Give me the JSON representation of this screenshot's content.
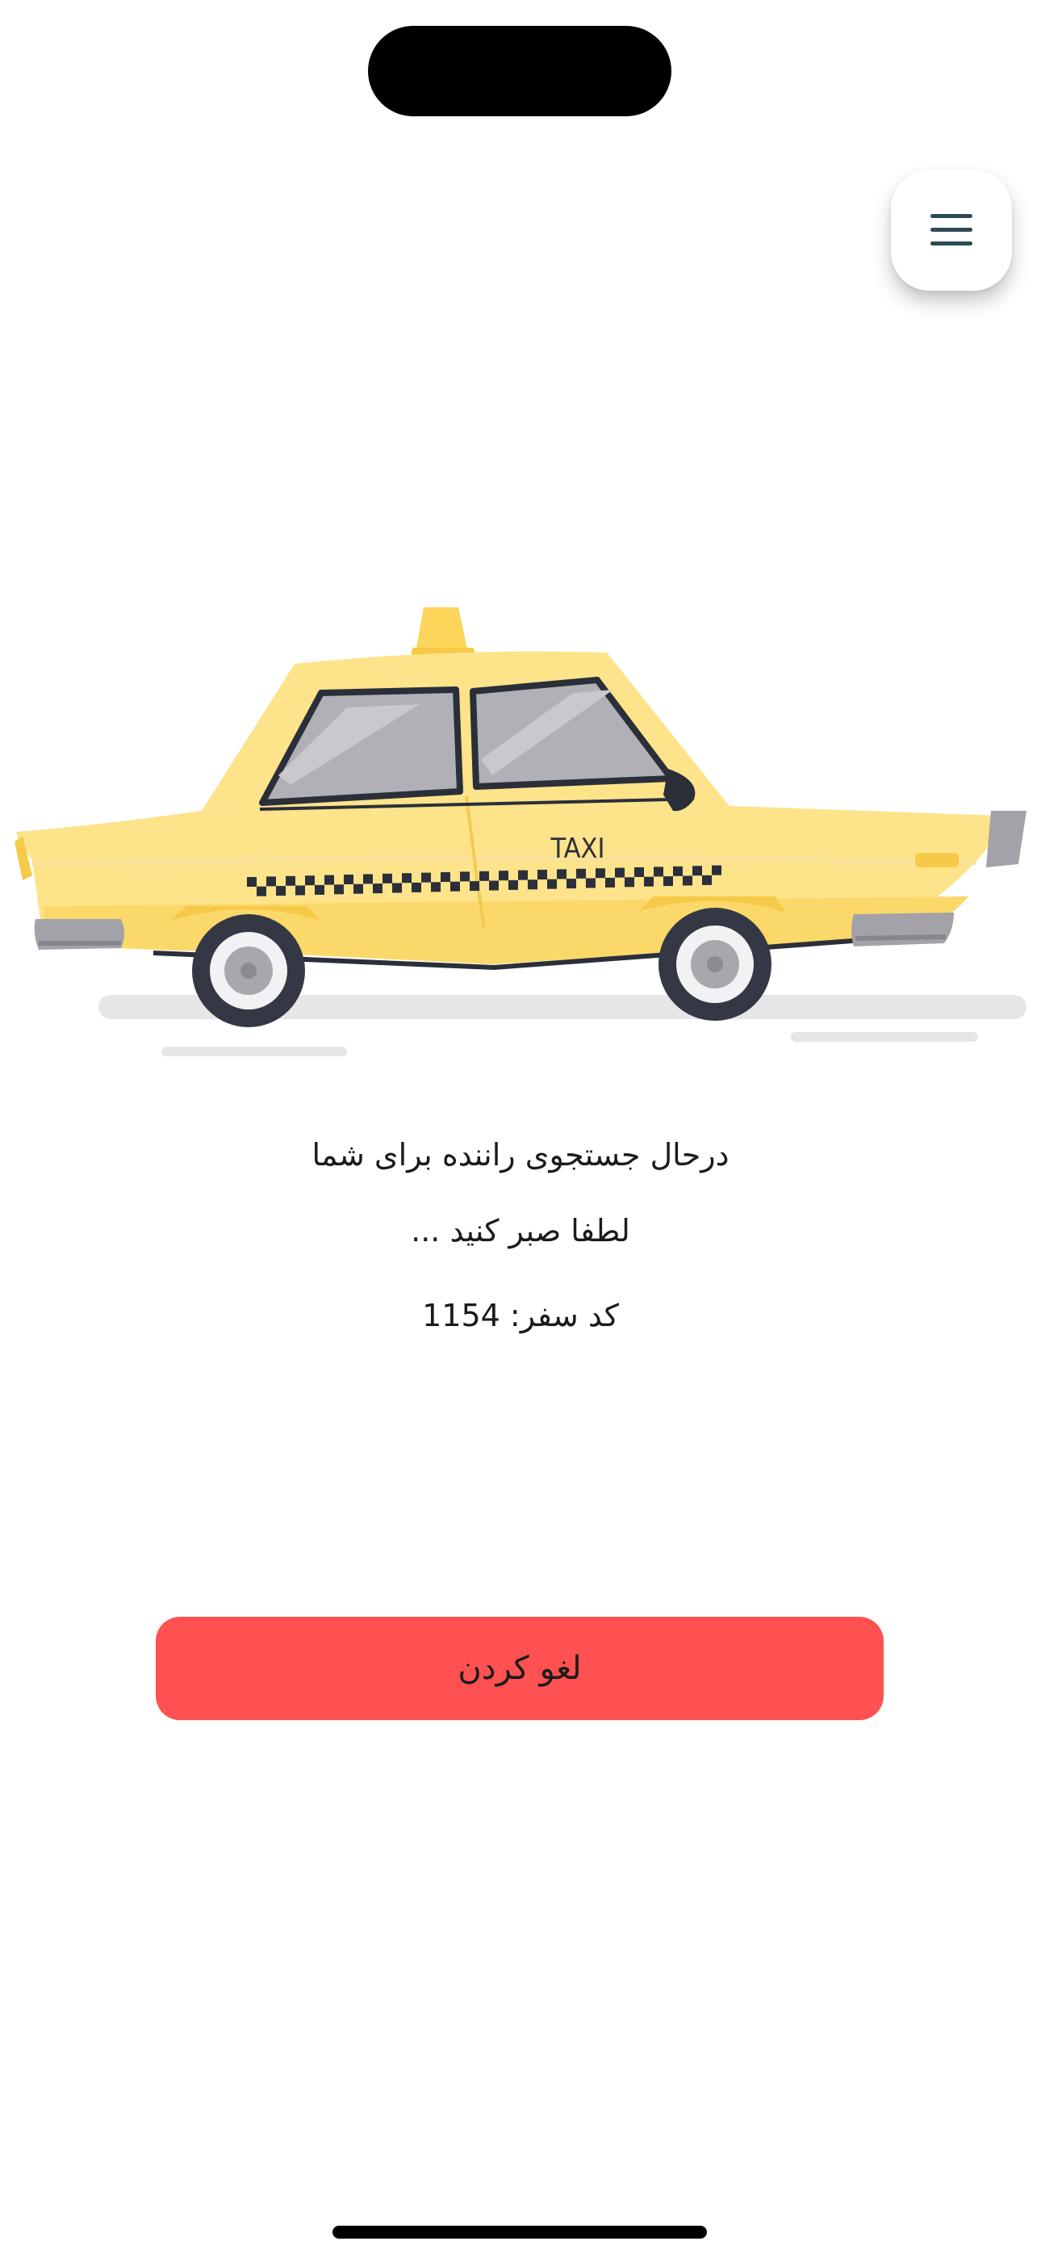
{
  "status": {
    "searching": "درحال جستجوی راننده برای شما",
    "wait": "لطفا صبر کنید ...",
    "trip_code": "کد سفر: 1154"
  },
  "cancel_button": {
    "label": "لغو کردن",
    "color": "#ff5151"
  },
  "taxi_illustration": {
    "sign": "TAXI",
    "body_color": "#fde38a"
  },
  "icons": {
    "menu": "hamburger-menu-icon"
  },
  "colors": {
    "menu_icon": "#2c4a55",
    "text": "#1b1b1b",
    "background": "#ffffff"
  }
}
